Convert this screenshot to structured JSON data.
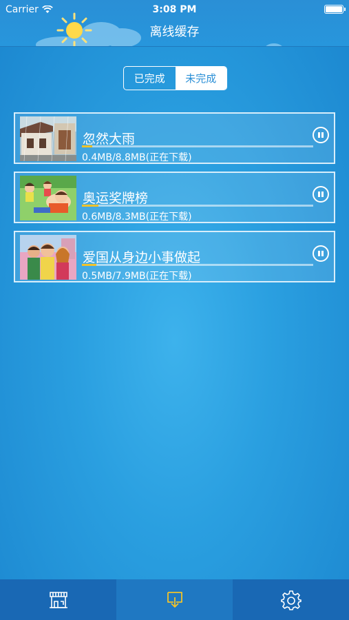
{
  "status_bar": {
    "carrier": "Carrier",
    "time": "3:08 PM"
  },
  "header": {
    "title": "离线缓存"
  },
  "segment": {
    "completed_label": "已完成",
    "incomplete_label": "未完成",
    "selected": "incomplete"
  },
  "downloads": [
    {
      "title": "忽然大雨",
      "size": "0.4MB/8.8MB(正在下载)",
      "progress": 0.045
    },
    {
      "title": "奥运奖牌榜",
      "size": "0.6MB/8.3MB(正在下载)",
      "progress": 0.072
    },
    {
      "title": "爱国从身边小事做起",
      "size": "0.5MB/7.9MB(正在下载)",
      "progress": 0.063
    }
  ],
  "tab_bar": {
    "tabs": [
      {
        "icon": "store-icon",
        "active": false
      },
      {
        "icon": "download-icon",
        "active": true
      },
      {
        "icon": "gear-icon",
        "active": false
      }
    ]
  },
  "colors": {
    "accent": "#2a8fd6",
    "progress": "#f3c329",
    "active_tab_icon": "#f3c329"
  }
}
